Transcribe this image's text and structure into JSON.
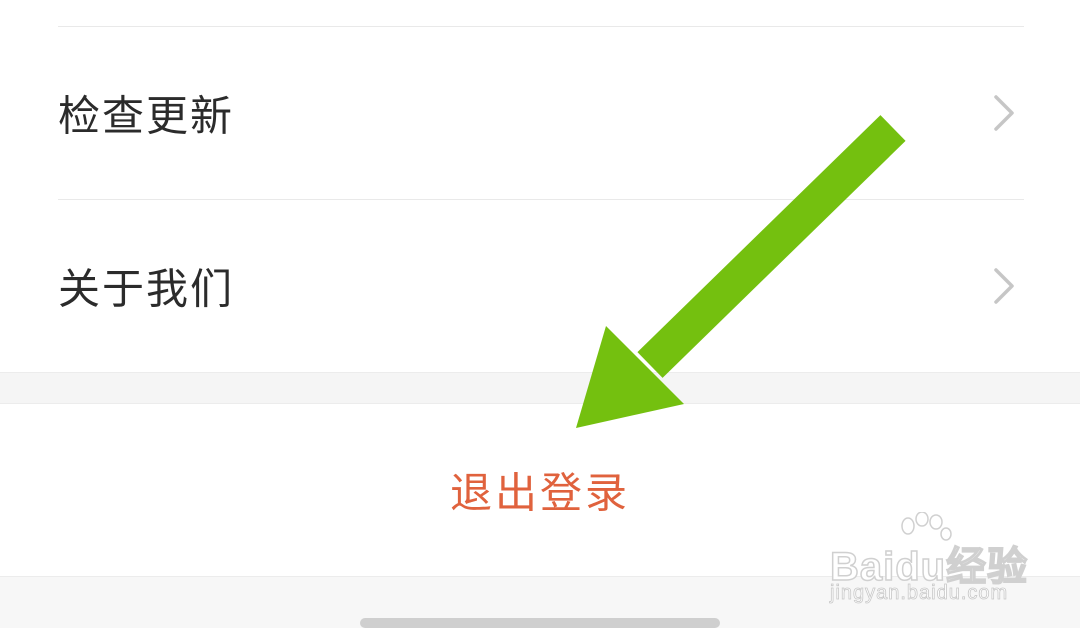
{
  "settings_list": {
    "items": [
      {
        "label": "检查更新",
        "icon": "chevron-right-icon"
      },
      {
        "label": "关于我们",
        "icon": "chevron-right-icon"
      }
    ]
  },
  "logout": {
    "label": "退出登录",
    "color": "#e0623d"
  },
  "annotation": {
    "icon": "green-arrow-icon",
    "color": "#74c00f"
  },
  "watermark": {
    "logo_text": "Baidu经验",
    "url": "jingyan.baidu.com"
  }
}
